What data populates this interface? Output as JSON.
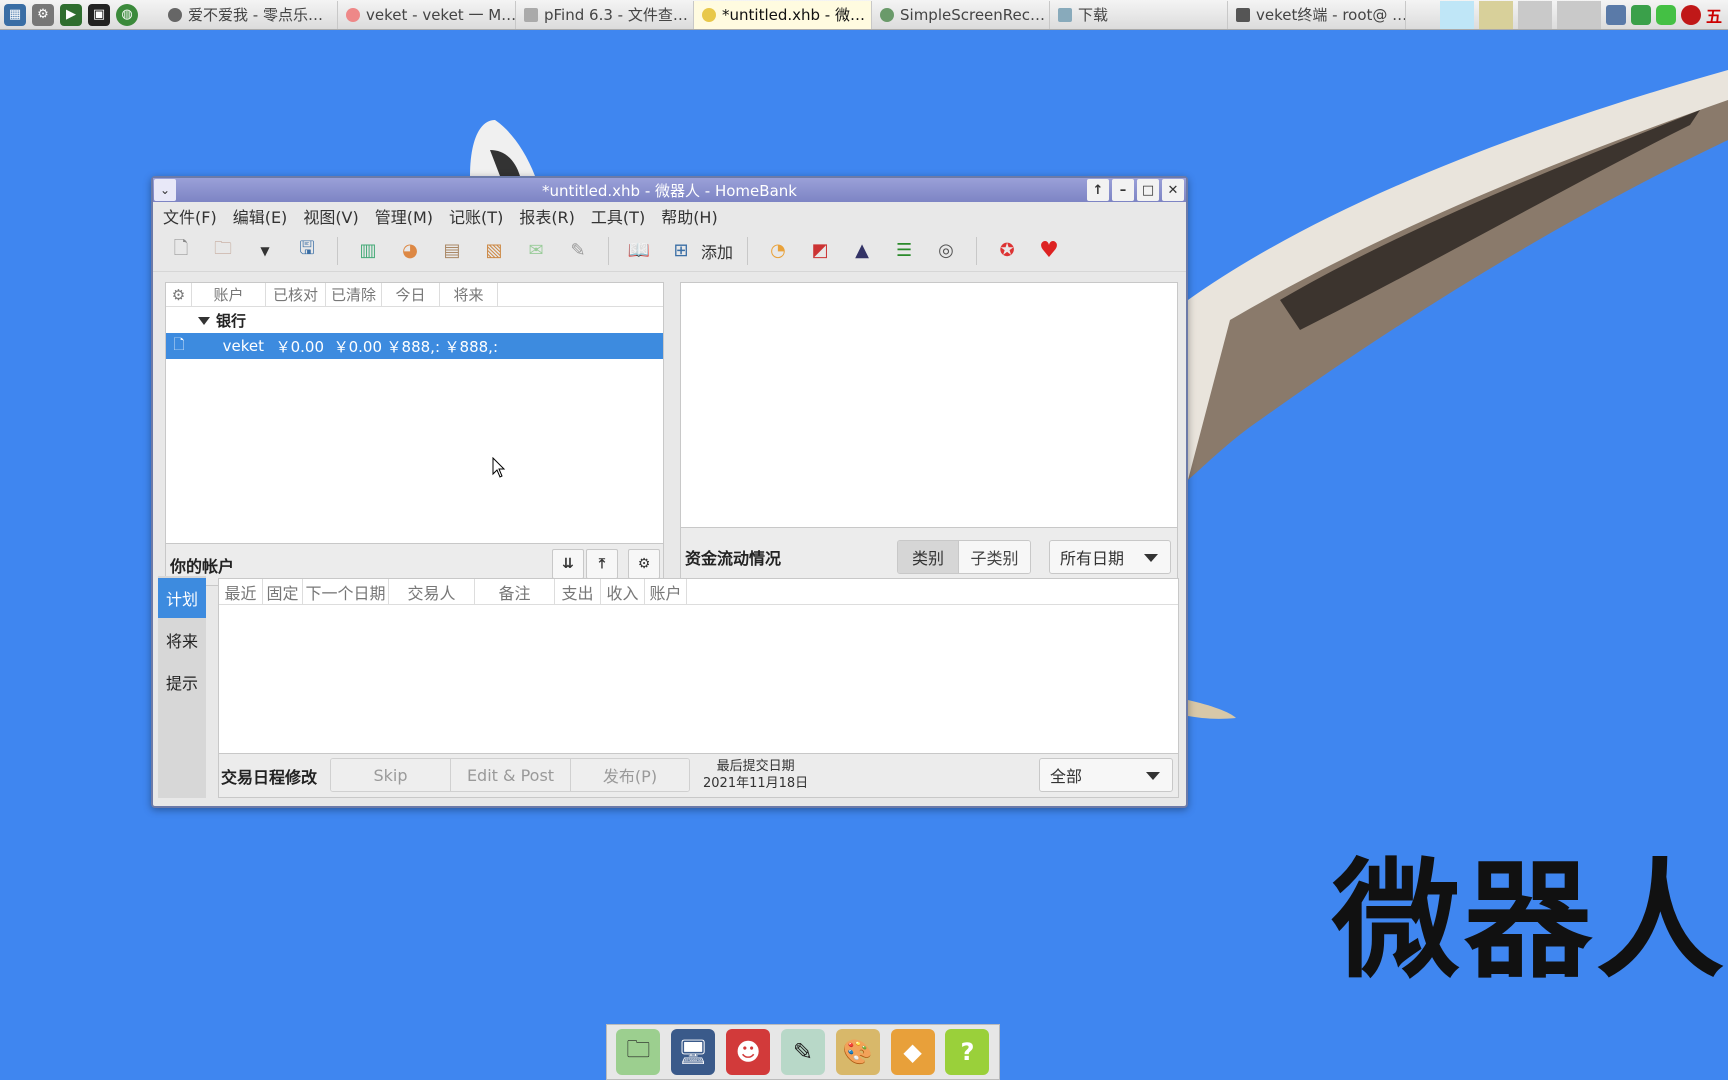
{
  "taskbar": {
    "tasks": [
      {
        "label": "爱不爱我 - 零点乐…",
        "icon": "music-icon"
      },
      {
        "label": "veket - veket 一 M…",
        "icon": "browser-icon"
      },
      {
        "label": "pFind 6.3 - 文件查…",
        "icon": "search-icon"
      },
      {
        "label": "*untitled.xhb - 微…",
        "icon": "homebank-icon"
      },
      {
        "label": "SimpleScreenRec…",
        "icon": "recorder-icon"
      },
      {
        "label": "下载",
        "icon": "folder-icon"
      },
      {
        "label": "veket终端 - root@ …",
        "icon": "terminal-icon"
      }
    ],
    "tray_input_method": "五"
  },
  "desktop": {
    "wallpaper_text": "微器人"
  },
  "window": {
    "title": "*untitled.xhb - 微器人 - HomeBank",
    "menu": [
      "文件(F)",
      "编辑(E)",
      "视图(V)",
      "管理(M)",
      "记账(T)",
      "报表(R)",
      "工具(T)",
      "帮助(H)"
    ],
    "toolbar_add_label": "添加",
    "accounts": {
      "columns": [
        "账户",
        "已核对",
        "已清除",
        "今日",
        "将来"
      ],
      "group": "银行",
      "rows": [
        {
          "name": "veket",
          "reconciled": "￥0.00",
          "cleared": "￥0.00",
          "today": "￥888,:",
          "future": "￥888,:"
        }
      ],
      "footer_title": "你的帐户"
    },
    "cashflow": {
      "footer_title": "资金流动情况",
      "segments": [
        "类别",
        "子类别"
      ],
      "active_segment": "类别",
      "date_range": "所有日期"
    },
    "schedule": {
      "tabs": [
        "计划",
        "将来",
        "提示"
      ],
      "active_tab": "计划",
      "columns": [
        "最近",
        "固定",
        "下一个日期",
        "交易人",
        "备注",
        "支出",
        "收入",
        "账户"
      ],
      "footer_title": "交易日程修改",
      "buttons": [
        "Skip",
        "Edit & Post",
        "发布(P)"
      ],
      "last_post_label": "最后提交日期",
      "last_post_date": "2021年11月18日",
      "filter": "全部"
    }
  },
  "colors": {
    "desktop": "#3f86f0",
    "selection": "#3d8bdf",
    "titlebar": "#8a90cf"
  }
}
